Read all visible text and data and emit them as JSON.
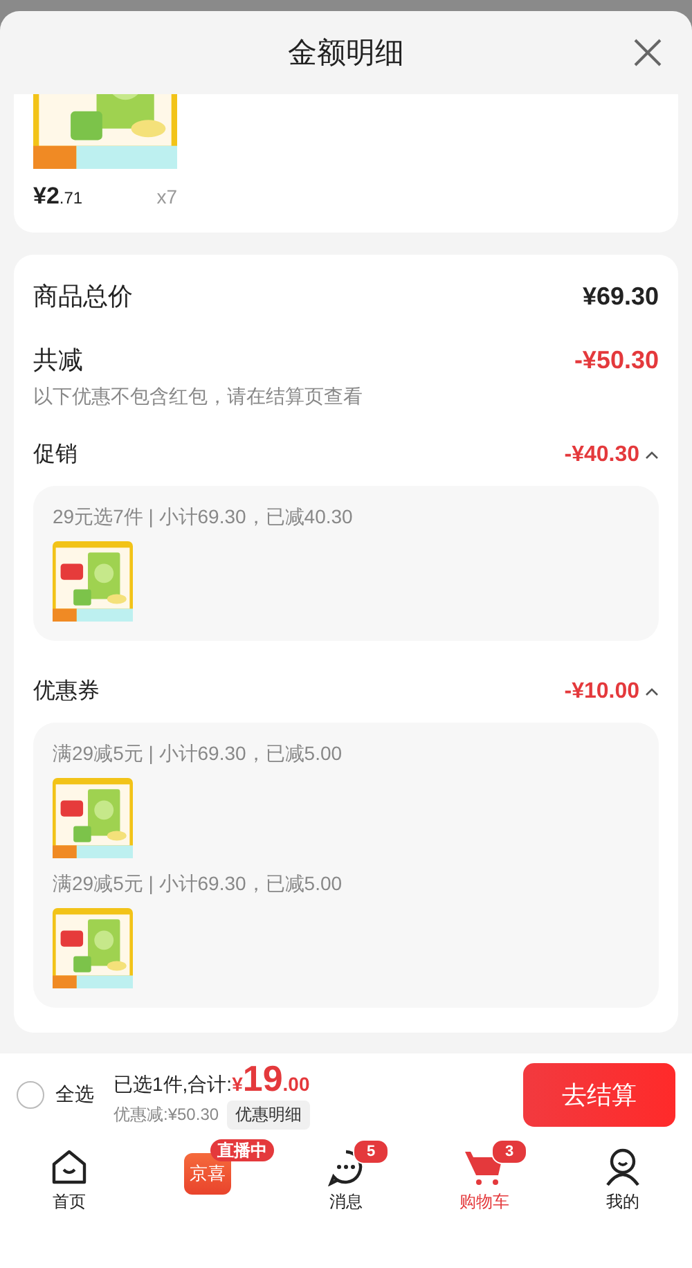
{
  "header": {
    "title": "金额明细"
  },
  "cart_item": {
    "price_main": "¥2",
    "price_decimal": ".71",
    "quantity": "x7"
  },
  "summary": {
    "total_label": "商品总价",
    "total": "¥69.30",
    "discount_label": "共减",
    "discount": "-¥50.30",
    "note": "以下优惠不包含红包，请在结算页查看"
  },
  "sections": [
    {
      "title": "促销",
      "amount": "-¥40.30",
      "expanded": true,
      "groups": [
        {
          "text": "29元选7件 | 小计69.30，已减40.30"
        }
      ]
    },
    {
      "title": "优惠券",
      "amount": "-¥10.00",
      "expanded": true,
      "groups": [
        {
          "text": "满29减5元 | 小计69.30，已减5.00"
        },
        {
          "text": "满29减5元 | 小计69.30，已减5.00"
        }
      ]
    }
  ],
  "checkout": {
    "select_all": {
      "label": "全选",
      "checked": false
    },
    "selected_text": "已选1件,合计:",
    "currency": "¥",
    "amount_int": "19",
    "amount_dec": ".00",
    "saving": "优惠减:¥50.30",
    "detail_button": "优惠明细",
    "checkout_button": "去结算"
  },
  "tabs": [
    {
      "kind": "home",
      "label": "首页",
      "selected": false
    },
    {
      "kind": "live",
      "label": "京喜",
      "badge": "直播中",
      "selected": false
    },
    {
      "kind": "message",
      "label": "消息",
      "badge": "5",
      "selected": false
    },
    {
      "kind": "cart",
      "label": "购物车",
      "badge": "3",
      "selected": true
    },
    {
      "kind": "profile",
      "label": "我的",
      "selected": false
    }
  ]
}
